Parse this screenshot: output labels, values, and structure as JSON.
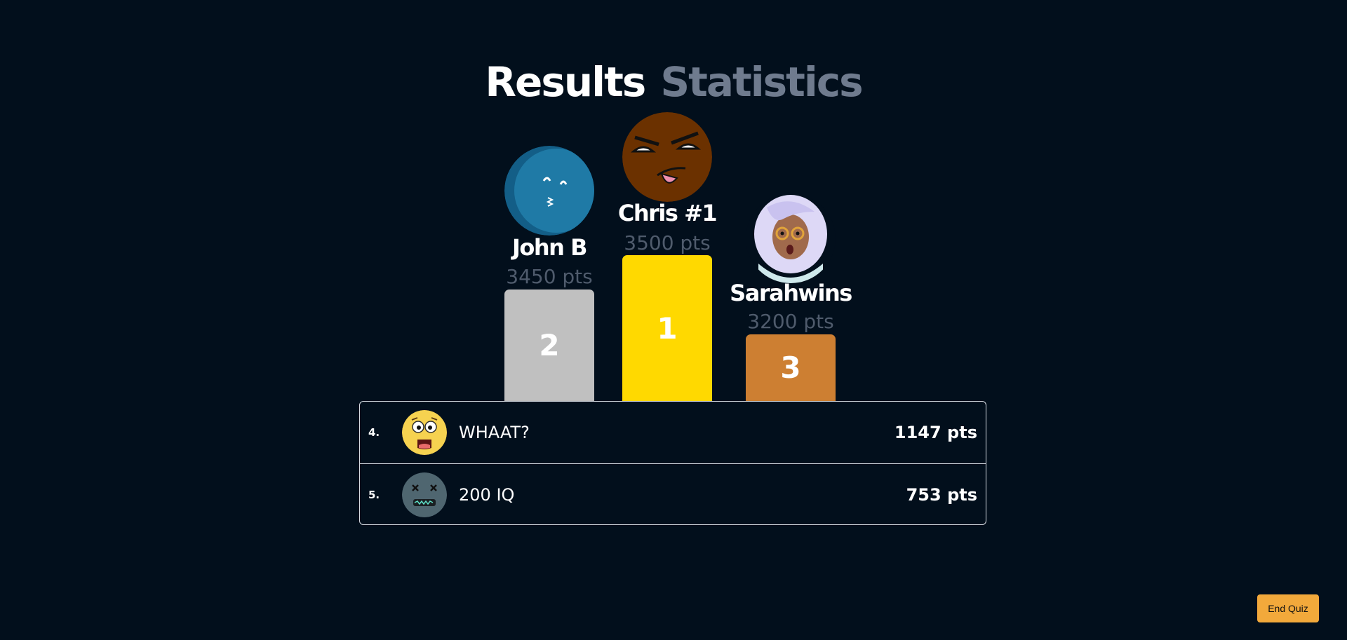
{
  "tabs": {
    "results": "Results",
    "statistics": "Statistics"
  },
  "podium": {
    "first": {
      "name": "Chris #1",
      "points": "3500 pts",
      "rank": "1",
      "avatar_icon": "smug-face-avatar",
      "color": "#ffd900"
    },
    "second": {
      "name": "John B",
      "points": "3450 pts",
      "rank": "2",
      "avatar_icon": "blue-ball-kiss-avatar",
      "color": "#c0c0c0"
    },
    "third": {
      "name": "Sarahwins",
      "points": "3200 pts",
      "rank": "3",
      "avatar_icon": "surprised-woman-avatar",
      "color": "#cd7f32"
    }
  },
  "leaderboard": [
    {
      "rank": "4.",
      "name": "WHAAT?",
      "points": "1147 pts",
      "avatar_icon": "shocked-emoji-avatar"
    },
    {
      "rank": "5.",
      "name": "200 IQ",
      "points": "753 pts",
      "avatar_icon": "dizzy-face-avatar"
    }
  ],
  "end_button": "End Quiz"
}
